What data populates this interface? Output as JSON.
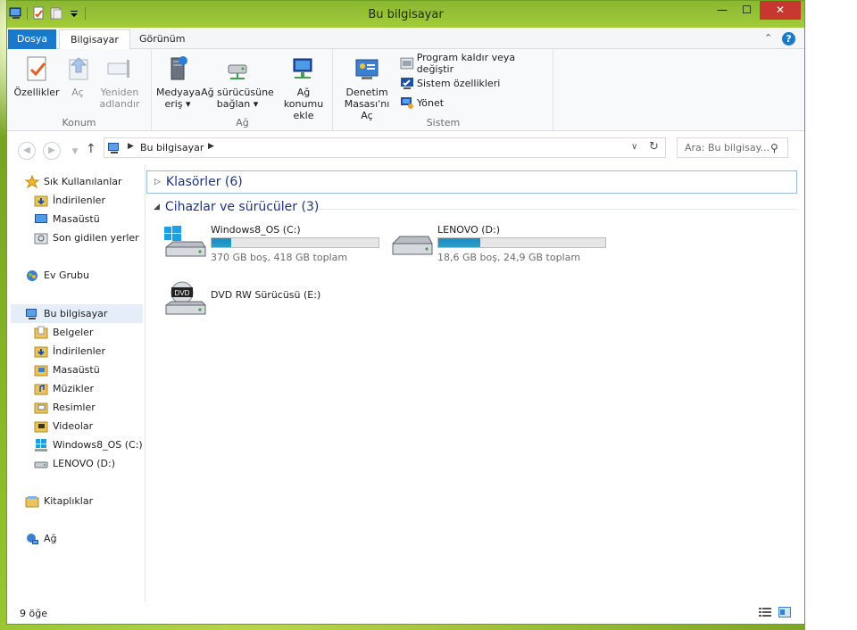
{
  "window": {
    "title": "Bu bilgisayar",
    "minimize": "—",
    "maximize": "☐",
    "close": "✕"
  },
  "ribbon_tabs": {
    "file": "Dosya",
    "computer": "Bilgisayar",
    "view": "Görünüm"
  },
  "ribbon": {
    "location": {
      "label": "Konum",
      "properties": "Özellikler",
      "open": "Aç",
      "rename_line1": "Yeniden",
      "rename_line2": "adlandır"
    },
    "network": {
      "label": "Ağ",
      "media_line1": "Medyaya",
      "media_line2": "eriş",
      "map_drive_line1": "Ağ sürücüsüne",
      "map_drive_line2": "bağlan",
      "add_location_line1": "Ağ konumu",
      "add_location_line2": "ekle"
    },
    "system": {
      "label": "Sistem",
      "control_panel_line1": "Denetim",
      "control_panel_line2": "Masası'nı Aç",
      "uninstall": "Program kaldır veya değiştir",
      "system_properties": "Sistem özellikleri",
      "manage": "Yönet"
    }
  },
  "address_bar": {
    "path": "Bu bilgisayar",
    "search_placeholder": "Ara: Bu bilgisay..."
  },
  "nav_pane": {
    "favorites": "Sık Kullanılanlar",
    "fav_downloads": "İndirilenler",
    "fav_desktop": "Masaüstü",
    "fav_recent": "Son gidilen yerler",
    "homegroup": "Ev Grubu",
    "this_pc": "Bu bilgisayar",
    "documents": "Belgeler",
    "downloads": "İndirilenler",
    "desktop": "Masaüstü",
    "music": "Müzikler",
    "pictures": "Resimler",
    "videos": "Videolar",
    "drive_c": "Windows8_OS (C:)",
    "drive_d": "LENOVO (D:)",
    "libraries": "Kitaplıklar",
    "network": "Ağ"
  },
  "content": {
    "folders_header": "Klasörler (6)",
    "drives_header": "Cihazlar ve sürücüler (3)",
    "drives": [
      {
        "name": "Windows8_OS (C:)",
        "info": "370 GB boş, 418 GB toplam",
        "used_fraction": 0.115
      },
      {
        "name": "LENOVO (D:)",
        "info": "18,6 GB boş, 24,9 GB toplam",
        "used_fraction": 0.253
      },
      {
        "name": "DVD RW Sürücüsü (E:)"
      }
    ]
  },
  "status": {
    "item_count": "9 öğe"
  },
  "colors": {
    "file_tab": "#1979ca",
    "drive_bar": "#26a0da",
    "close_button": "#c7372f"
  }
}
